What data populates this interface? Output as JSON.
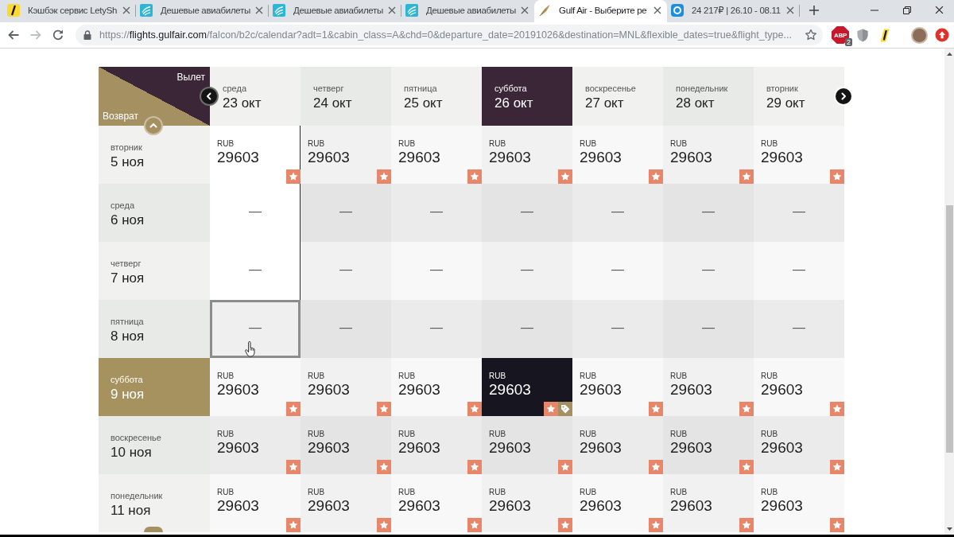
{
  "browser": {
    "tabs": [
      {
        "kind": "lety",
        "title": "Кэшбэк сервис LetySh",
        "selected": false
      },
      {
        "kind": "cloud",
        "title": "Дешевые авиабилеты",
        "selected": false
      },
      {
        "kind": "cloud",
        "title": "Дешевые авиабилеты",
        "selected": false
      },
      {
        "kind": "cloud",
        "title": "Дешевые авиабилеты",
        "selected": false
      },
      {
        "kind": "falcon",
        "title": "Gulf Air - Выберите ре",
        "selected": true
      },
      {
        "kind": "app",
        "title": "24 217₽ | 26.10 - 08.11",
        "selected": false
      }
    ],
    "nav": [
      {
        "kind": "back",
        "disabled": false
      },
      {
        "kind": "forward",
        "disabled": true
      },
      {
        "kind": "reload",
        "disabled": false
      }
    ],
    "address": {
      "scheme": "https://",
      "host": "flights.gulfair.com",
      "path": "/falcon/b2c/calendar?adt=1&cabin_class=A&chd=0&departure_date=20191026&destination=MNL&flexible_dates=true&flight_type..."
    },
    "extensions": [
      {
        "kind": "adblock",
        "label": "ABP",
        "badge": "2"
      },
      {
        "kind": "shield"
      },
      {
        "kind": "lety"
      },
      {
        "kind": "avatar"
      },
      {
        "kind": "upload"
      }
    ]
  },
  "calendar": {
    "corner": {
      "departure_label": "Вылет",
      "return_label": "Возврат"
    },
    "columns": [
      {
        "weekday": "среда",
        "date": "23 окт",
        "selected": false
      },
      {
        "weekday": "четверг",
        "date": "24 окт",
        "selected": false
      },
      {
        "weekday": "пятница",
        "date": "25 окт",
        "selected": false
      },
      {
        "weekday": "суббота",
        "date": "26 окт",
        "selected": true
      },
      {
        "weekday": "воскресенье",
        "date": "27 окт",
        "selected": false
      },
      {
        "weekday": "понедельник",
        "date": "28 окт",
        "selected": false
      },
      {
        "weekday": "вторник",
        "date": "29 окт",
        "selected": false
      }
    ],
    "rows": [
      {
        "weekday": "вторник",
        "date": "5 ноя",
        "selected": false,
        "cells": [
          {
            "kind": "price",
            "currency": "RUB",
            "price": "29603",
            "selected": false,
            "hovered": false,
            "highlighted": true
          },
          {
            "kind": "price",
            "currency": "RUB",
            "price": "29603",
            "selected": false,
            "hovered": false,
            "highlighted": false
          },
          {
            "kind": "price",
            "currency": "RUB",
            "price": "29603",
            "selected": false,
            "hovered": false,
            "highlighted": false
          },
          {
            "kind": "price",
            "currency": "RUB",
            "price": "29603",
            "selected": false,
            "hovered": false,
            "highlighted": false
          },
          {
            "kind": "price",
            "currency": "RUB",
            "price": "29603",
            "selected": false,
            "hovered": false,
            "highlighted": false
          },
          {
            "kind": "price",
            "currency": "RUB",
            "price": "29603",
            "selected": false,
            "hovered": false,
            "highlighted": false
          },
          {
            "kind": "price",
            "currency": "RUB",
            "price": "29603",
            "selected": false,
            "hovered": false,
            "highlighted": false
          }
        ]
      },
      {
        "weekday": "среда",
        "date": "6 ноя",
        "selected": false,
        "cells": [
          {
            "kind": "empty",
            "text": "—",
            "selected": false,
            "hovered": false,
            "highlighted": true
          },
          {
            "kind": "empty",
            "text": "—",
            "selected": false,
            "hovered": false,
            "highlighted": false
          },
          {
            "kind": "empty",
            "text": "—",
            "selected": false,
            "hovered": false,
            "highlighted": false
          },
          {
            "kind": "empty",
            "text": "—",
            "selected": false,
            "hovered": false,
            "highlighted": false
          },
          {
            "kind": "empty",
            "text": "—",
            "selected": false,
            "hovered": false,
            "highlighted": false
          },
          {
            "kind": "empty",
            "text": "—",
            "selected": false,
            "hovered": false,
            "highlighted": false
          },
          {
            "kind": "empty",
            "text": "—",
            "selected": false,
            "hovered": false,
            "highlighted": false
          }
        ]
      },
      {
        "weekday": "четверг",
        "date": "7 ноя",
        "selected": false,
        "cells": [
          {
            "kind": "empty",
            "text": "—",
            "selected": false,
            "hovered": false,
            "highlighted": true
          },
          {
            "kind": "empty",
            "text": "—",
            "selected": false,
            "hovered": false,
            "highlighted": false
          },
          {
            "kind": "empty",
            "text": "—",
            "selected": false,
            "hovered": false,
            "highlighted": false
          },
          {
            "kind": "empty",
            "text": "—",
            "selected": false,
            "hovered": false,
            "highlighted": false
          },
          {
            "kind": "empty",
            "text": "—",
            "selected": false,
            "hovered": false,
            "highlighted": false
          },
          {
            "kind": "empty",
            "text": "—",
            "selected": false,
            "hovered": false,
            "highlighted": false
          },
          {
            "kind": "empty",
            "text": "—",
            "selected": false,
            "hovered": false,
            "highlighted": false
          }
        ]
      },
      {
        "weekday": "пятница",
        "date": "8 ноя",
        "selected": false,
        "cells": [
          {
            "kind": "empty",
            "text": "—",
            "selected": false,
            "hovered": true,
            "highlighted": false
          },
          {
            "kind": "empty",
            "text": "—",
            "selected": false,
            "hovered": false,
            "highlighted": false
          },
          {
            "kind": "empty",
            "text": "—",
            "selected": false,
            "hovered": false,
            "highlighted": false
          },
          {
            "kind": "empty",
            "text": "—",
            "selected": false,
            "hovered": false,
            "highlighted": false
          },
          {
            "kind": "empty",
            "text": "—",
            "selected": false,
            "hovered": false,
            "highlighted": false
          },
          {
            "kind": "empty",
            "text": "—",
            "selected": false,
            "hovered": false,
            "highlighted": false
          },
          {
            "kind": "empty",
            "text": "—",
            "selected": false,
            "hovered": false,
            "highlighted": false
          }
        ]
      },
      {
        "weekday": "суббота",
        "date": "9 ноя",
        "selected": true,
        "cells": [
          {
            "kind": "price",
            "currency": "RUB",
            "price": "29603",
            "selected": false,
            "hovered": false,
            "highlighted": false
          },
          {
            "kind": "price",
            "currency": "RUB",
            "price": "29603",
            "selected": false,
            "hovered": false,
            "highlighted": false
          },
          {
            "kind": "price",
            "currency": "RUB",
            "price": "29603",
            "selected": false,
            "hovered": false,
            "highlighted": false
          },
          {
            "kind": "price",
            "currency": "RUB",
            "price": "29603",
            "selected": true,
            "hovered": false,
            "highlighted": false
          },
          {
            "kind": "price",
            "currency": "RUB",
            "price": "29603",
            "selected": false,
            "hovered": false,
            "highlighted": false
          },
          {
            "kind": "price",
            "currency": "RUB",
            "price": "29603",
            "selected": false,
            "hovered": false,
            "highlighted": false
          },
          {
            "kind": "price",
            "currency": "RUB",
            "price": "29603",
            "selected": false,
            "hovered": false,
            "highlighted": false
          }
        ]
      },
      {
        "weekday": "воскресенье",
        "date": "10 ноя",
        "selected": false,
        "cells": [
          {
            "kind": "price",
            "currency": "RUB",
            "price": "29603",
            "selected": false,
            "hovered": false,
            "highlighted": false
          },
          {
            "kind": "price",
            "currency": "RUB",
            "price": "29603",
            "selected": false,
            "hovered": false,
            "highlighted": false
          },
          {
            "kind": "price",
            "currency": "RUB",
            "price": "29603",
            "selected": false,
            "hovered": false,
            "highlighted": false
          },
          {
            "kind": "price",
            "currency": "RUB",
            "price": "29603",
            "selected": false,
            "hovered": false,
            "highlighted": false
          },
          {
            "kind": "price",
            "currency": "RUB",
            "price": "29603",
            "selected": false,
            "hovered": false,
            "highlighted": false
          },
          {
            "kind": "price",
            "currency": "RUB",
            "price": "29603",
            "selected": false,
            "hovered": false,
            "highlighted": false
          },
          {
            "kind": "price",
            "currency": "RUB",
            "price": "29603",
            "selected": false,
            "hovered": false,
            "highlighted": false
          }
        ]
      },
      {
        "weekday": "понедельник",
        "date": "11 ноя",
        "selected": false,
        "cells": [
          {
            "kind": "price",
            "currency": "RUB",
            "price": "29603",
            "selected": false,
            "hovered": false,
            "highlighted": false
          },
          {
            "kind": "price",
            "currency": "RUB",
            "price": "29603",
            "selected": false,
            "hovered": false,
            "highlighted": false
          },
          {
            "kind": "price",
            "currency": "RUB",
            "price": "29603",
            "selected": false,
            "hovered": false,
            "highlighted": false
          },
          {
            "kind": "price",
            "currency": "RUB",
            "price": "29603",
            "selected": false,
            "hovered": false,
            "highlighted": false
          },
          {
            "kind": "price",
            "currency": "RUB",
            "price": "29603",
            "selected": false,
            "hovered": false,
            "highlighted": false
          },
          {
            "kind": "price",
            "currency": "RUB",
            "price": "29603",
            "selected": false,
            "hovered": false,
            "highlighted": false
          },
          {
            "kind": "price",
            "currency": "RUB",
            "price": "29603",
            "selected": false,
            "hovered": false,
            "highlighted": false
          }
        ]
      }
    ]
  }
}
